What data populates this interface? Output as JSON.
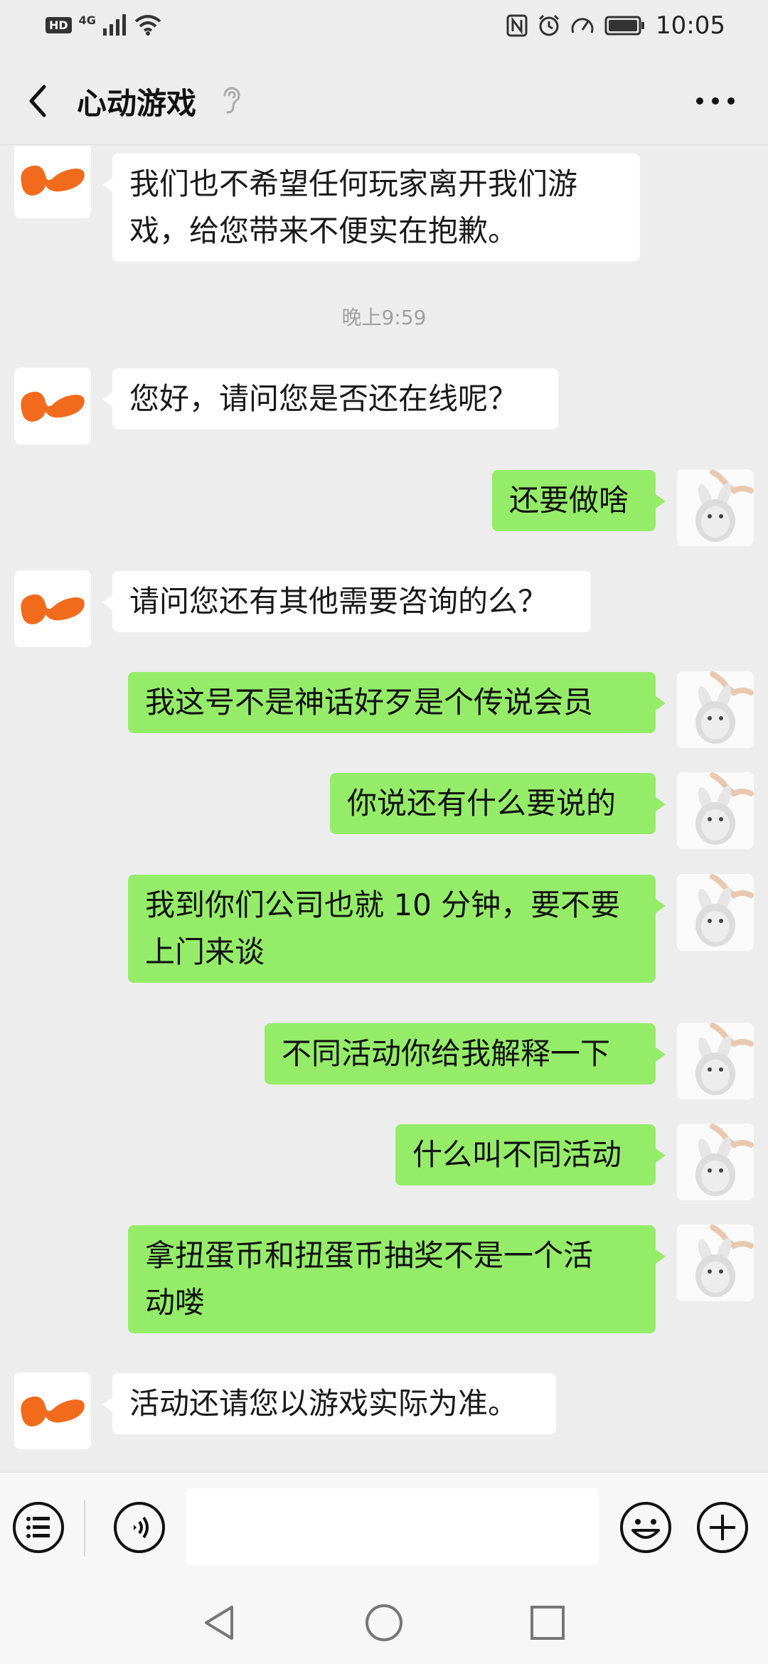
{
  "status_bar": {
    "hd_badge": "HD",
    "network": "4G",
    "time": "10:05",
    "icons": [
      "signal-icon",
      "wifi-icon",
      "nfc-icon",
      "alarm-icon",
      "speed-icon",
      "battery-icon"
    ]
  },
  "header": {
    "title": "心动游戏",
    "icons": [
      "back-arrow-icon",
      "ear-icon",
      "more-dots-icon"
    ]
  },
  "messages": {
    "m1_line1": "我们也不希望任何玩家离开我们游",
    "m1_line2": "戏，给您带来不便实在抱歉。",
    "timestamp": "晚上9:59",
    "m2": "您好，请问您是否还在线呢？",
    "m3": "还要做啥",
    "m4": "请问您还有其他需要咨询的么？",
    "m5": "我这号不是神话好歹是个传说会员",
    "m6": "你说还有什么要说的",
    "m7_line1": "我到你们公司也就 10 分钟，要不要",
    "m7_line2": "上门来谈",
    "m8": "不同活动你给我解释一下",
    "m9": "什么叫不同活动",
    "m10_line1": "拿扭蛋币和扭蛋币抽奖不是一个活",
    "m10_line2": "动喽",
    "m11": "活动还请您以游戏实际为准。"
  },
  "input_bar": {
    "value": "",
    "icons": [
      "menu-list-icon",
      "voice-icon",
      "emoji-icon",
      "plus-icon"
    ]
  },
  "nav_bar": {
    "icons": [
      "nav-back-icon",
      "nav-home-icon",
      "nav-recents-icon"
    ]
  },
  "colors": {
    "background": "#ededed",
    "outgoing_bubble": "#95ec69",
    "incoming_bubble": "#ffffff",
    "brand_orange": "#f26b1d"
  }
}
